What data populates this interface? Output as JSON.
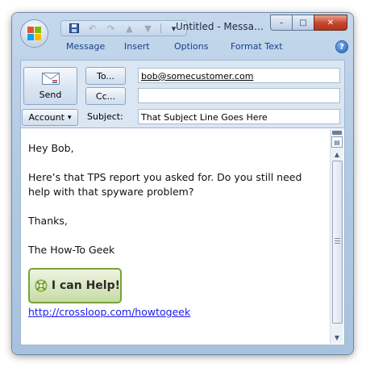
{
  "window": {
    "title": "Untitled - Messa…",
    "controls": {
      "minimize": "–",
      "maximize": "□",
      "close": "✕"
    }
  },
  "quick_access": {
    "save_icon": "save-icon",
    "undo_icon": "undo-icon",
    "redo_icon": "redo-icon",
    "up_icon": "arrow-up-icon",
    "down_icon": "arrow-down-icon",
    "more_icon": "customize-dropdown-icon"
  },
  "ribbon": {
    "tabs": [
      "Message",
      "Insert",
      "Options",
      "Format Text"
    ],
    "help": "?"
  },
  "header": {
    "send_label": "Send",
    "to_label": "To...",
    "cc_label": "Cc...",
    "account_label": "Account",
    "account_arrow": "▾",
    "subject_label": "Subject:",
    "to_value": "bob@somecustomer.com",
    "cc_value": "",
    "subject_value": "That Subject Line Goes Here"
  },
  "message": {
    "greeting": "Hey Bob,",
    "line1": "Here’s that TPS report you asked for. Do you still need help with that spyware problem?",
    "closing": "Thanks,",
    "signature": "The How-To Geek",
    "badge_text": "I can Help!",
    "link": "http://crossloop.com/howtogeek"
  },
  "colors": {
    "accent": "#15428b",
    "frame": "#b3cbe4",
    "link": "#1a1aee",
    "badge_border": "#78a23d"
  }
}
